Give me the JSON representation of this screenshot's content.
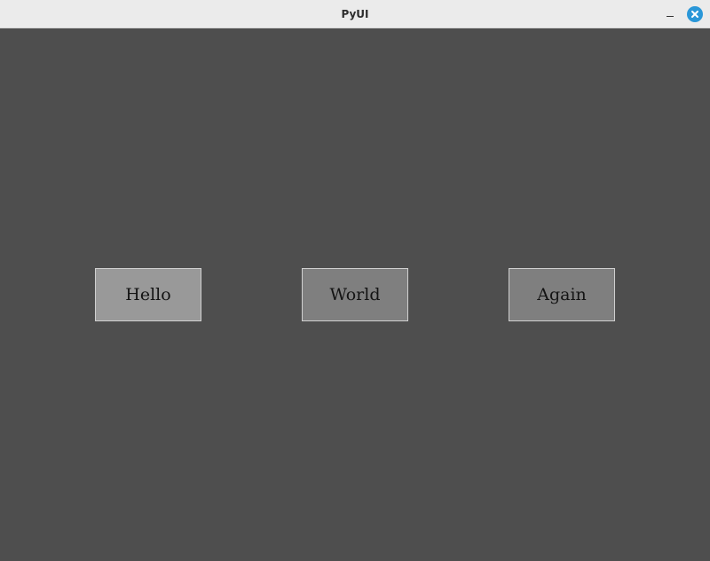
{
  "window": {
    "title": "PyUI"
  },
  "buttons": {
    "hello": {
      "label": "Hello"
    },
    "world": {
      "label": "World"
    },
    "again": {
      "label": "Again"
    }
  },
  "colors": {
    "background": "#4e4e4e",
    "titlebar": "#ebebeb",
    "close_accent": "#2a97d8",
    "button_hover": "#999999",
    "button_normal": "#7f7f7f"
  },
  "icons": {
    "minimize": "minimize-icon",
    "close": "close-icon"
  }
}
